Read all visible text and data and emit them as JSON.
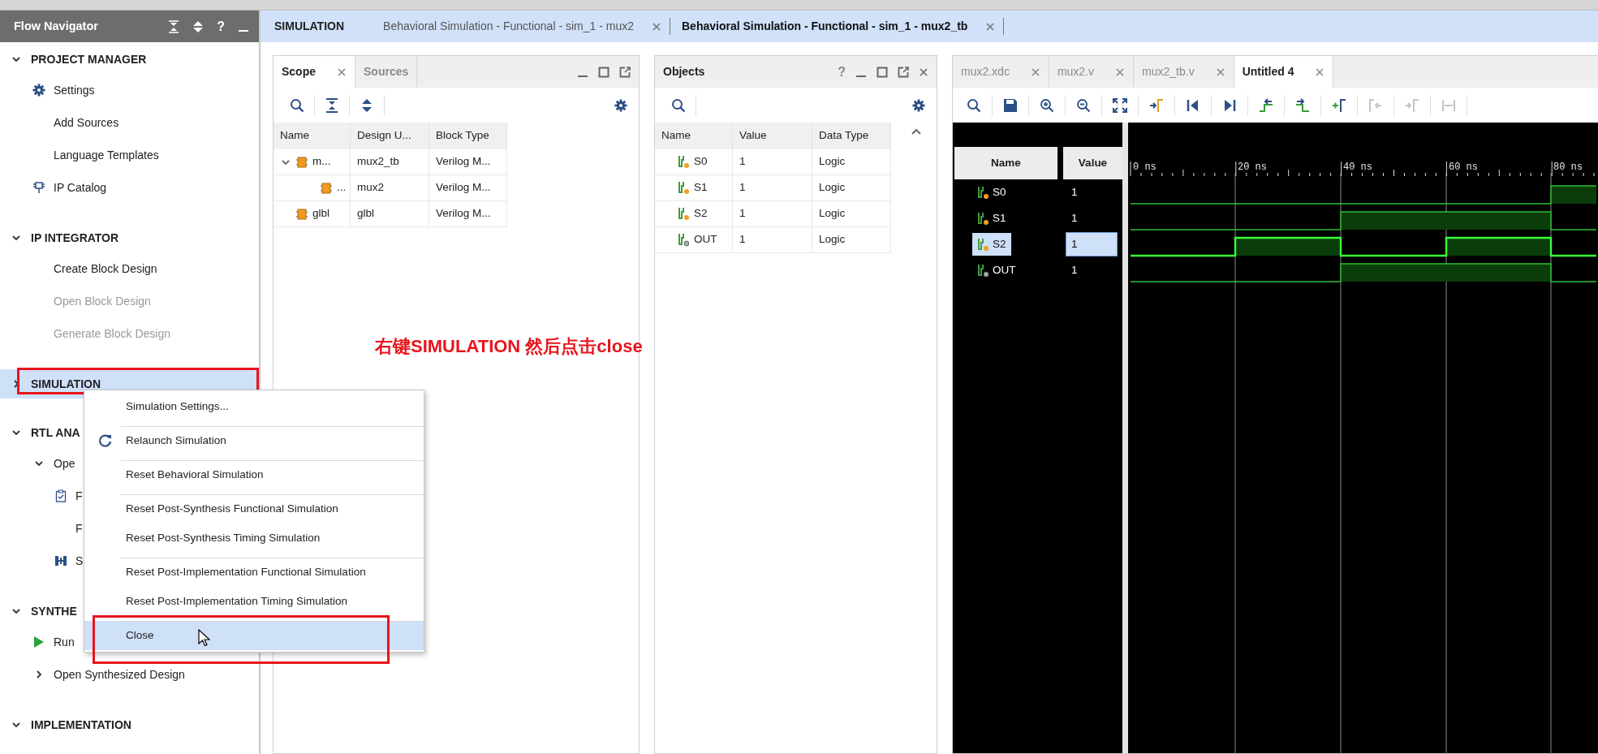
{
  "flow_navigator": {
    "title": "Flow Navigator",
    "help": "?",
    "sections": [
      {
        "label": "PROJECT MANAGER",
        "expanded": true,
        "selected": false,
        "annotated": false,
        "children": [
          {
            "label": "Settings",
            "kind": "settings",
            "disabled": false
          },
          {
            "label": "Add Sources",
            "kind": "link",
            "disabled": false
          },
          {
            "label": "Language Templates",
            "kind": "link",
            "disabled": false
          },
          {
            "label": "IP Catalog",
            "kind": "catalog",
            "disabled": false
          }
        ]
      },
      {
        "label": "IP INTEGRATOR",
        "expanded": true,
        "selected": false,
        "annotated": false,
        "children": [
          {
            "label": "Create Block Design",
            "kind": "link",
            "disabled": false
          },
          {
            "label": "Open Block Design",
            "kind": "link",
            "disabled": true
          },
          {
            "label": "Generate Block Design",
            "kind": "link",
            "disabled": true
          }
        ]
      },
      {
        "label": "SIMULATION",
        "expanded": false,
        "selected": true,
        "annotated": true
      },
      {
        "label": "RTL ANA",
        "expanded": true,
        "selected": false,
        "annotated": false,
        "children": [
          {
            "label": "Ope",
            "kind": "submenu",
            "disabled": false,
            "expanded": true,
            "children": [
              {
                "label": "F",
                "kind": "checklist",
                "disabled": false
              },
              {
                "label": "F",
                "kind": "link",
                "disabled": false
              },
              {
                "label": "S",
                "kind": "schematic",
                "disabled": false
              }
            ]
          }
        ]
      },
      {
        "label": "SYNTHE",
        "expanded": true,
        "selected": false,
        "annotated": false,
        "children": [
          {
            "label": "Run",
            "kind": "run",
            "disabled": false
          },
          {
            "label": "Open Synthesized Design",
            "kind": "submenu",
            "disabled": false,
            "expanded": false
          }
        ]
      },
      {
        "label": "IMPLEMENTATION",
        "expanded": true,
        "selected": false,
        "annotated": false
      }
    ]
  },
  "context_menu": [
    {
      "label": "Simulation Settings...",
      "kind": "action",
      "separator": false,
      "selected": false,
      "annotated": false
    },
    {
      "label": "Relaunch Simulation",
      "kind": "refresh",
      "separator": true,
      "selected": false,
      "annotated": false
    },
    {
      "label": "Reset Behavioral Simulation",
      "kind": "action",
      "separator": true,
      "selected": false,
      "annotated": false
    },
    {
      "label": "Reset Post-Synthesis Functional Simulation",
      "kind": "action",
      "separator": true,
      "selected": false,
      "annotated": false
    },
    {
      "label": "Reset Post-Synthesis Timing Simulation",
      "kind": "action",
      "separator": false,
      "selected": false,
      "annotated": false
    },
    {
      "label": "Reset Post-Implementation Functional Simulation",
      "kind": "action",
      "separator": true,
      "selected": false,
      "annotated": false
    },
    {
      "label": "Reset Post-Implementation Timing Simulation",
      "kind": "action",
      "separator": false,
      "selected": false,
      "annotated": false
    },
    {
      "label": "Close",
      "kind": "action",
      "separator": true,
      "selected": true,
      "annotated": true
    }
  ],
  "annotation": "右键SIMULATION 然后点击close",
  "simulation_bar": {
    "label": "SIMULATION",
    "tabs": [
      {
        "label": "Behavioral Simulation - Functional - sim_1 - mux2",
        "selected": false
      },
      {
        "label": "Behavioral Simulation - Functional - sim_1 - mux2_tb",
        "selected": true
      }
    ]
  },
  "scope_panel": {
    "tabs": [
      {
        "label": "Scope",
        "selected": true,
        "closable": true
      },
      {
        "label": "Sources",
        "selected": false,
        "closable": false
      }
    ],
    "columns": [
      "Name",
      "Design U...",
      "Block Type"
    ],
    "rows": [
      {
        "name": "m...",
        "design_unit": "mux2_tb",
        "block_type": "Verilog M...",
        "expanded": true,
        "children": [
          {
            "name": "...",
            "design_unit": "mux2",
            "block_type": "Verilog M..."
          }
        ]
      },
      {
        "name": "glbl",
        "design_unit": "glbl",
        "block_type": "Verilog M..."
      }
    ]
  },
  "objects_panel": {
    "title": "Objects",
    "help": "?",
    "columns": [
      "Name",
      "Value",
      "Data Type"
    ],
    "rows": [
      {
        "name": "S0",
        "value": "1",
        "data_type": "Logic",
        "kind": "input"
      },
      {
        "name": "S1",
        "value": "1",
        "data_type": "Logic",
        "kind": "input"
      },
      {
        "name": "S2",
        "value": "1",
        "data_type": "Logic",
        "kind": "input"
      },
      {
        "name": "OUT",
        "value": "1",
        "data_type": "Logic",
        "kind": "output"
      }
    ]
  },
  "wave_panel": {
    "tabs": [
      {
        "label": "mux2.xdc",
        "selected": false
      },
      {
        "label": "mux2.v",
        "selected": false
      },
      {
        "label": "mux2_tb.v",
        "selected": false
      },
      {
        "label": "Untitled 4",
        "selected": true
      }
    ],
    "toolbar": [
      {
        "kind": "search",
        "disabled": false
      },
      {
        "kind": "save",
        "disabled": false
      },
      {
        "kind": "zoom-in",
        "disabled": false
      },
      {
        "kind": "zoom-out",
        "disabled": false
      },
      {
        "kind": "zoom-fit",
        "disabled": false
      },
      {
        "kind": "go-cursor",
        "disabled": false
      },
      {
        "kind": "go-start",
        "disabled": false
      },
      {
        "kind": "go-end",
        "disabled": false
      },
      {
        "kind": "prev-edge",
        "disabled": false
      },
      {
        "kind": "next-edge",
        "disabled": false
      },
      {
        "kind": "add-marker",
        "disabled": false
      },
      {
        "kind": "prev-marker",
        "disabled": true
      },
      {
        "kind": "next-marker",
        "disabled": true
      },
      {
        "kind": "swap",
        "disabled": true
      }
    ],
    "columns": [
      "Name",
      "Value"
    ],
    "signals": [
      {
        "name": "S0",
        "value": "1",
        "kind": "input",
        "selected": false
      },
      {
        "name": "S1",
        "value": "1",
        "kind": "input",
        "selected": false
      },
      {
        "name": "S2",
        "value": "1",
        "kind": "input",
        "selected": true
      },
      {
        "name": "OUT",
        "value": "1",
        "kind": "output",
        "selected": false
      }
    ],
    "timeline": [
      "0 ns",
      "20 ns",
      "40 ns",
      "60 ns",
      "80 ns"
    ]
  }
}
